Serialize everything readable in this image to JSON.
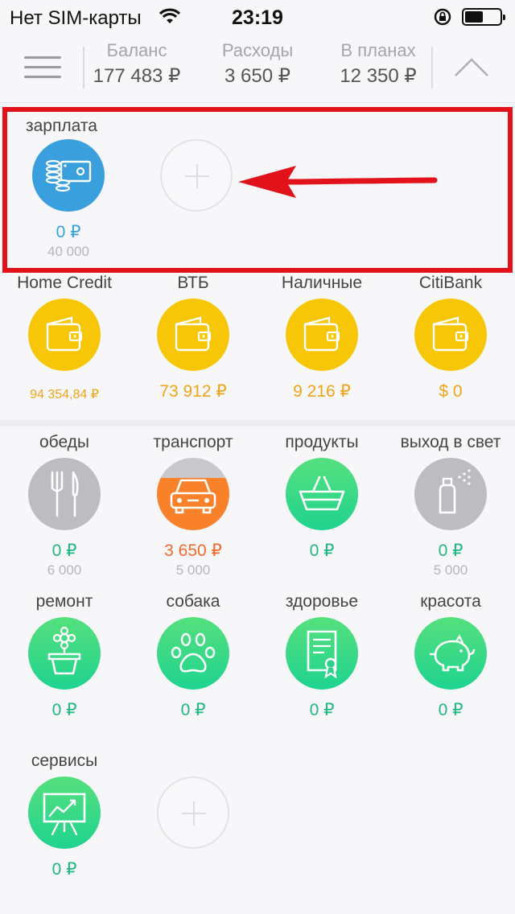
{
  "status_bar": {
    "carrier": "Нет SIM-карты",
    "time": "23:19"
  },
  "header": {
    "balance_label": "Баланс",
    "balance_value": "177 483 ₽",
    "expenses_label": "Расходы",
    "expenses_value": "3 650 ₽",
    "planned_label": "В планах",
    "planned_value": "12 350 ₽"
  },
  "income": {
    "label": "зарплата",
    "amount": "0 ₽",
    "plan": "40 000"
  },
  "accounts": [
    {
      "name": "Home Credit",
      "amount": "94 354,84 ₽"
    },
    {
      "name": "ВТБ",
      "amount": "73 912 ₽"
    },
    {
      "name": "Наличные",
      "amount": "9 216 ₽"
    },
    {
      "name": "CitiBank",
      "amount": "$ 0"
    }
  ],
  "categories": [
    {
      "name": "обеды",
      "amount": "0 ₽",
      "plan": "6 000",
      "icon": "fork-knife-icon"
    },
    {
      "name": "транспорт",
      "amount": "3 650 ₽",
      "plan": "5 000",
      "icon": "car-icon",
      "progress": 0.73
    },
    {
      "name": "продукты",
      "amount": "0 ₽",
      "icon": "basket-icon"
    },
    {
      "name": "выход в свет",
      "amount": "0 ₽",
      "plan": "5 000",
      "icon": "perfume-icon"
    },
    {
      "name": "ремонт",
      "amount": "0 ₽",
      "icon": "flower-pot-icon"
    },
    {
      "name": "собака",
      "amount": "0 ₽",
      "icon": "paw-icon"
    },
    {
      "name": "здоровье",
      "amount": "0 ₽",
      "icon": "certificate-icon"
    },
    {
      "name": "красота",
      "amount": "0 ₽",
      "icon": "piggy-bank-icon"
    },
    {
      "name": "сервисы",
      "amount": "0 ₽",
      "icon": "chart-board-icon"
    }
  ],
  "colors": {
    "income": "#3aa0dd",
    "account": "#f7c707",
    "category": "#2ed68a",
    "category_planned": "#bdbdc1",
    "overspend": "#f9812a",
    "highlight_frame": "#e2121b"
  }
}
